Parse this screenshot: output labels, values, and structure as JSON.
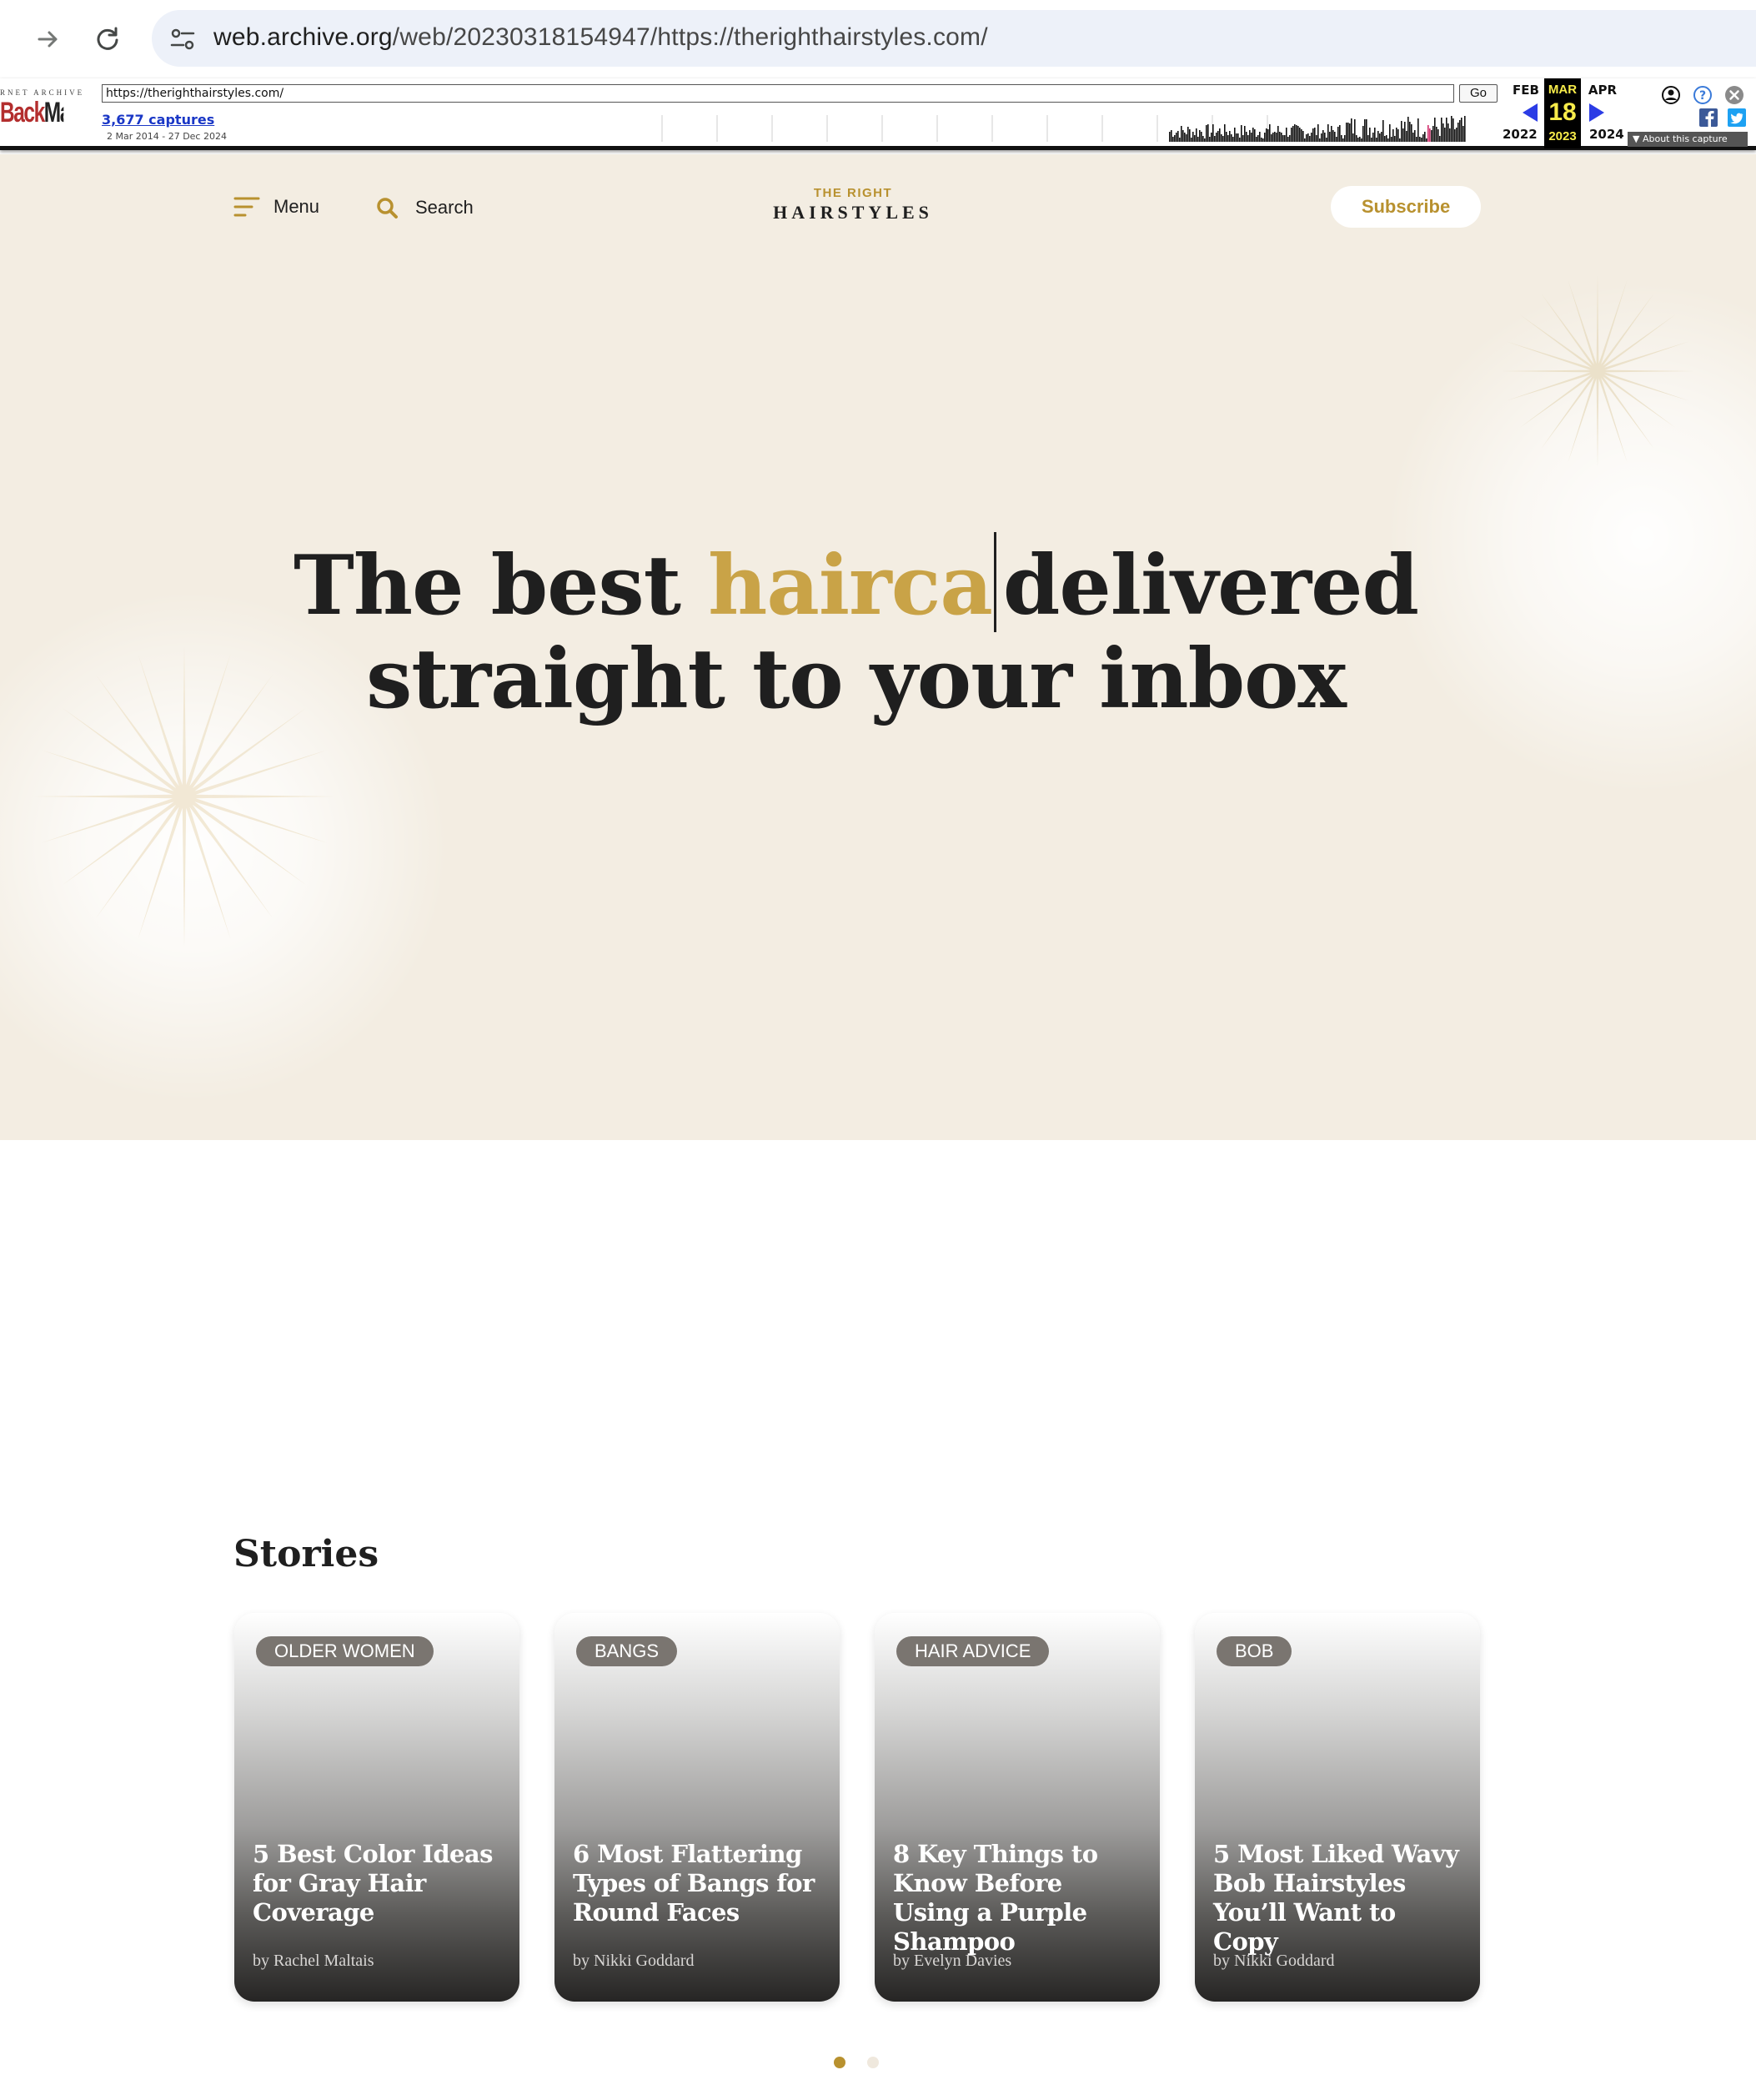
{
  "browser": {
    "url_domain": "web.archive.org",
    "url_path": "/web/20230318154947/https://therighthairstyles.com/"
  },
  "wayback": {
    "archive_small": "RNET ARCHIVE",
    "logo_back": "Back",
    "logo_machine": "Machine",
    "url_value": "https://therighthairstyles.com/",
    "go_label": "Go",
    "captures": "3,677 captures",
    "date_range": "2 Mar 2014 - 27 Dec 2024",
    "prev_month": "FEB",
    "current_month": "MAR",
    "next_month": "APR",
    "current_day": "18",
    "prev_year": "2022",
    "current_year": "2023",
    "next_year": "2024",
    "about_label": "About this capture"
  },
  "site": {
    "menu_label": "Menu",
    "search_label": "Search",
    "logo_small": "THE RIGHT",
    "logo_big": "HAIRSTYLES",
    "subscribe_label": "Subscribe"
  },
  "hero": {
    "title_before": "The best ",
    "title_typed": "hairca",
    "title_after": "delivered",
    "title_line2": "straight to your inbox"
  },
  "stories": {
    "heading": "Stories",
    "cards": [
      {
        "category": "OLDER WOMEN",
        "title": "5 Best Color Ideas for Gray Hair Coverage",
        "author": "by Rachel Maltais"
      },
      {
        "category": "BANGS",
        "title": "6 Most Flattering Types of Bangs for Round Faces",
        "author": "by Nikki Goddard"
      },
      {
        "category": "HAIR ADVICE",
        "title": "8 Key Things to Know Before Using a Purple Shampoo",
        "author": "by Evelyn Davies"
      },
      {
        "category": "BOB",
        "title": "5 Most Liked Wavy Bob Hairstyles You’ll Want to Copy",
        "author": "by Nikki Goddard"
      }
    ]
  },
  "colors": {
    "gold": "#b8912f",
    "hero_bg": "#f3ede2",
    "wayback_link": "#1a37c6"
  },
  "icons": [
    "back-arrow-icon",
    "reload-icon",
    "site-info-icon",
    "hamburger-menu-icon",
    "search-icon",
    "account-icon",
    "help-icon",
    "close-icon",
    "facebook-icon",
    "twitter-icon"
  ]
}
